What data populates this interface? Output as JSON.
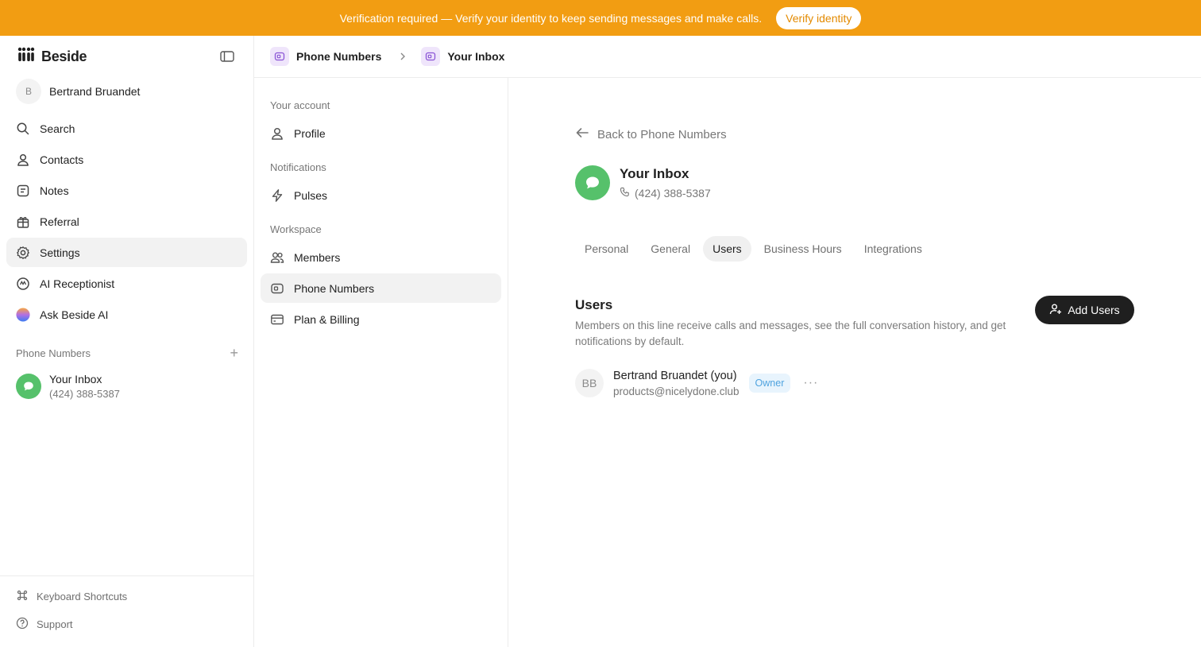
{
  "banner": {
    "text": "Verification required — Verify your identity to keep sending messages and make calls.",
    "button": "Verify identity"
  },
  "sidebar": {
    "brand": "Beside",
    "user": {
      "initial": "B",
      "name": "Bertrand Bruandet"
    },
    "items": [
      {
        "label": "Search",
        "icon": "search-icon"
      },
      {
        "label": "Contacts",
        "icon": "contacts-icon"
      },
      {
        "label": "Notes",
        "icon": "notes-icon"
      },
      {
        "label": "Referral",
        "icon": "gift-icon"
      },
      {
        "label": "Settings",
        "icon": "gear-icon",
        "active": true
      },
      {
        "label": "AI Receptionist",
        "icon": "ai-icon"
      },
      {
        "label": "Ask Beside AI",
        "icon": "gradient-orb-icon"
      }
    ],
    "phone_section_label": "Phone Numbers",
    "inbox": {
      "name": "Your Inbox",
      "phone": "(424) 388-5387"
    },
    "bottom": [
      {
        "label": "Keyboard Shortcuts",
        "icon": "command-icon"
      },
      {
        "label": "Support",
        "icon": "help-icon"
      }
    ]
  },
  "breadcrumb": {
    "parent": "Phone Numbers",
    "current": "Your Inbox"
  },
  "settings_menu": {
    "sections": [
      {
        "label": "Your account",
        "items": [
          {
            "label": "Profile",
            "icon": "user-icon"
          }
        ]
      },
      {
        "label": "Notifications",
        "items": [
          {
            "label": "Pulses",
            "icon": "bolt-icon"
          }
        ]
      },
      {
        "label": "Workspace",
        "items": [
          {
            "label": "Members",
            "icon": "members-icon"
          },
          {
            "label": "Phone Numbers",
            "icon": "phone-number-icon",
            "active": true
          },
          {
            "label": "Plan & Billing",
            "icon": "card-icon"
          }
        ]
      }
    ]
  },
  "main": {
    "back_label": "Back to Phone Numbers",
    "inbox_title": "Your Inbox",
    "inbox_phone": "(424) 388-5387",
    "tabs": [
      {
        "label": "Personal"
      },
      {
        "label": "General"
      },
      {
        "label": "Users",
        "active": true
      },
      {
        "label": "Business Hours"
      },
      {
        "label": "Integrations"
      }
    ],
    "users_title": "Users",
    "users_description": "Members on this line receive calls and messages, see the full conversation history, and get notifications by default.",
    "add_button": "Add Users",
    "members": [
      {
        "initials": "BB",
        "name": "Bertrand Bruandet (you)",
        "email": "products@nicelydone.club",
        "role": "Owner"
      }
    ]
  },
  "colors": {
    "banner": "#f29d12",
    "accent_green": "#56c16b",
    "crumb_icon_bg": "#efe5fb",
    "owner_badge_bg": "#e8f4fd",
    "owner_badge_text": "#4fa3df"
  }
}
